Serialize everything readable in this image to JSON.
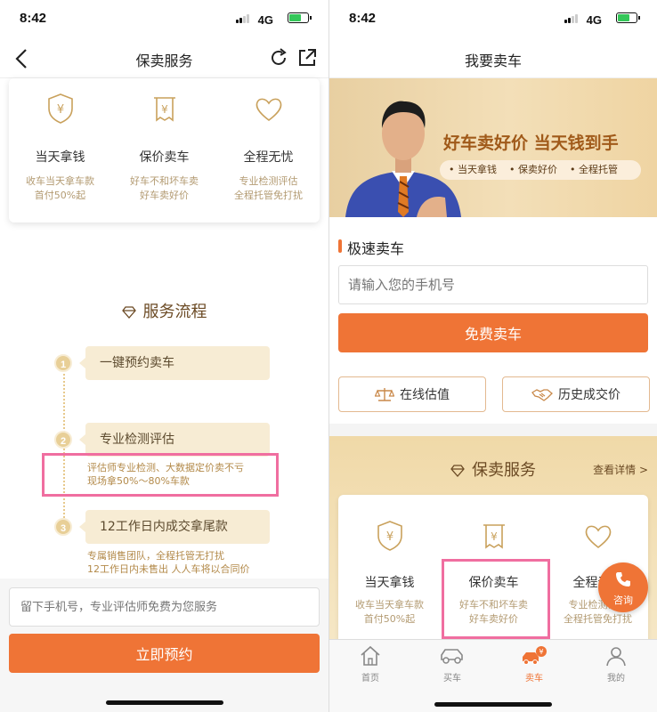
{
  "colors": {
    "accent": "#ef7436",
    "gold": "#b39b72",
    "highlight": "#f06ea0"
  },
  "status_bar": {
    "time": "8:42",
    "network": "4G"
  },
  "left": {
    "nav_title": "保卖服务",
    "benefits": [
      {
        "icon": "yen-shield-icon",
        "title": "当天拿钱",
        "line1": "收车当天拿车款",
        "line2": "首付50%起"
      },
      {
        "icon": "receipt-icon",
        "title": "保价卖车",
        "line1": "好车不和坏车卖",
        "line2": "好车卖好价"
      },
      {
        "icon": "heart-icon",
        "title": "全程无忧",
        "line1": "专业检测评估",
        "line2": "全程托管免打扰"
      }
    ],
    "flow_title": "服务流程",
    "steps": [
      {
        "num": "1",
        "title": "一键预约卖车",
        "desc1": "",
        "desc2": ""
      },
      {
        "num": "2",
        "title": "专业检测评估",
        "desc1": "评估师专业检测、大数据定价卖不亏",
        "desc2": "现场拿50%～80%车款"
      },
      {
        "num": "3",
        "title": "12工作日内成交拿尾款",
        "desc1": "专属销售团队，全程托管无打扰",
        "desc2": "12工作日内未售出 人人车将以合同价"
      }
    ],
    "input_placeholder": "留下手机号，专业评估师免费为您服务",
    "submit_label": "立即预约"
  },
  "right": {
    "nav_title": "我要卖车",
    "banner": {
      "slogan": "好车卖好价 当天钱到手",
      "tags": [
        "• 当天拿钱",
        "• 保卖好价",
        "• 全程托管"
      ]
    },
    "section_title": "极速卖车",
    "phone_placeholder": "请输入您的手机号",
    "sell_label": "免费卖车",
    "online_value_label": "在线估值",
    "history_label": "历史成交价",
    "service_title": "保卖服务",
    "detail_link": "查看详情 >",
    "benefits": [
      {
        "icon": "yen-shield-icon",
        "title": "当天拿钱",
        "line1": "收车当天拿车款",
        "line2": "首付50%起"
      },
      {
        "icon": "receipt-icon",
        "title": "保价卖车",
        "line1": "好车不和坏车卖",
        "line2": "好车卖好价"
      },
      {
        "icon": "heart-icon",
        "title": "全程无忧",
        "line1": "专业检测评估",
        "line2": "全程托管免打扰"
      }
    ],
    "consult_label": "咨询",
    "tabs": [
      {
        "icon": "home-icon",
        "label": "首页",
        "active": false
      },
      {
        "icon": "car-icon",
        "label": "买车",
        "active": false
      },
      {
        "icon": "sell-car-icon",
        "label": "卖车",
        "active": true
      },
      {
        "icon": "user-icon",
        "label": "我的",
        "active": false
      }
    ]
  }
}
